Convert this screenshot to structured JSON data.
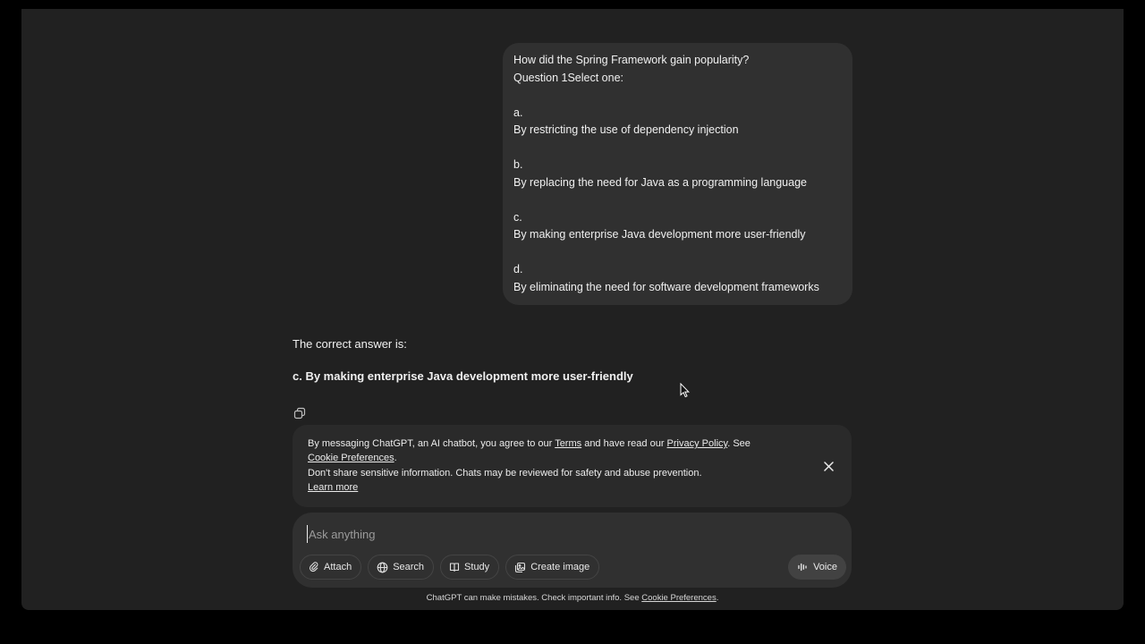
{
  "user_message": {
    "lines": [
      "How did the Spring Framework gain popularity?",
      "Question 1Select one:",
      "",
      "a.",
      "By restricting the use of dependency injection",
      "",
      "b.",
      "By replacing the need for Java as a programming language",
      "",
      "c.",
      "By making enterprise Java development more user-friendly",
      "",
      "d.",
      "By eliminating the need for software development frameworks"
    ]
  },
  "assistant_message": {
    "intro": "The correct answer is:",
    "answer": "c. By making enterprise Java development more user-friendly",
    "copy_icon": "copy-icon"
  },
  "notice": {
    "text_1": "By messaging ChatGPT, an AI chatbot, you agree to our ",
    "terms_link": "Terms",
    "text_2": " and have read our ",
    "privacy_link": "Privacy Policy",
    "text_3": ". See ",
    "cookie_link": "Cookie Preferences",
    "text_4": ".",
    "text_5": "Don't share sensitive information. Chats may be reviewed for safety and abuse prevention.",
    "learn_more_link": "Learn more",
    "close_icon": "close-icon"
  },
  "composer": {
    "placeholder": "Ask anything",
    "value": "",
    "tools": {
      "attach": "Attach",
      "search": "Search",
      "study": "Study",
      "create_image": "Create image"
    },
    "voice": "Voice"
  },
  "footer": {
    "text": "ChatGPT can make mistakes. Check important info. See ",
    "cookie_link": "Cookie Preferences",
    "end": "."
  },
  "colors": {
    "background": "#212121",
    "bubble": "#303030",
    "notice": "#2a2a2a",
    "text": "#ececec"
  }
}
